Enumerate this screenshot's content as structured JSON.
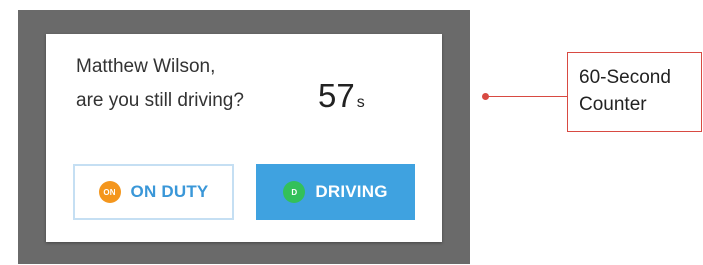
{
  "dialog": {
    "question_line1": "Matthew Wilson,",
    "question_line2": "are you still driving?",
    "counter_value": "57",
    "counter_unit": "s",
    "on_duty_button": {
      "badge": "ON",
      "label": "ON DUTY"
    },
    "driving_button": {
      "badge": "D",
      "label": "DRIVING"
    }
  },
  "annotation": {
    "line1": "60-Second",
    "line2": "Counter"
  },
  "colors": {
    "frame": "#6a6a6a",
    "primary_blue": "#3fa2e0",
    "on_duty_badge": "#f4961d",
    "driving_badge": "#33c05a",
    "annotation_red": "#d84a42"
  }
}
